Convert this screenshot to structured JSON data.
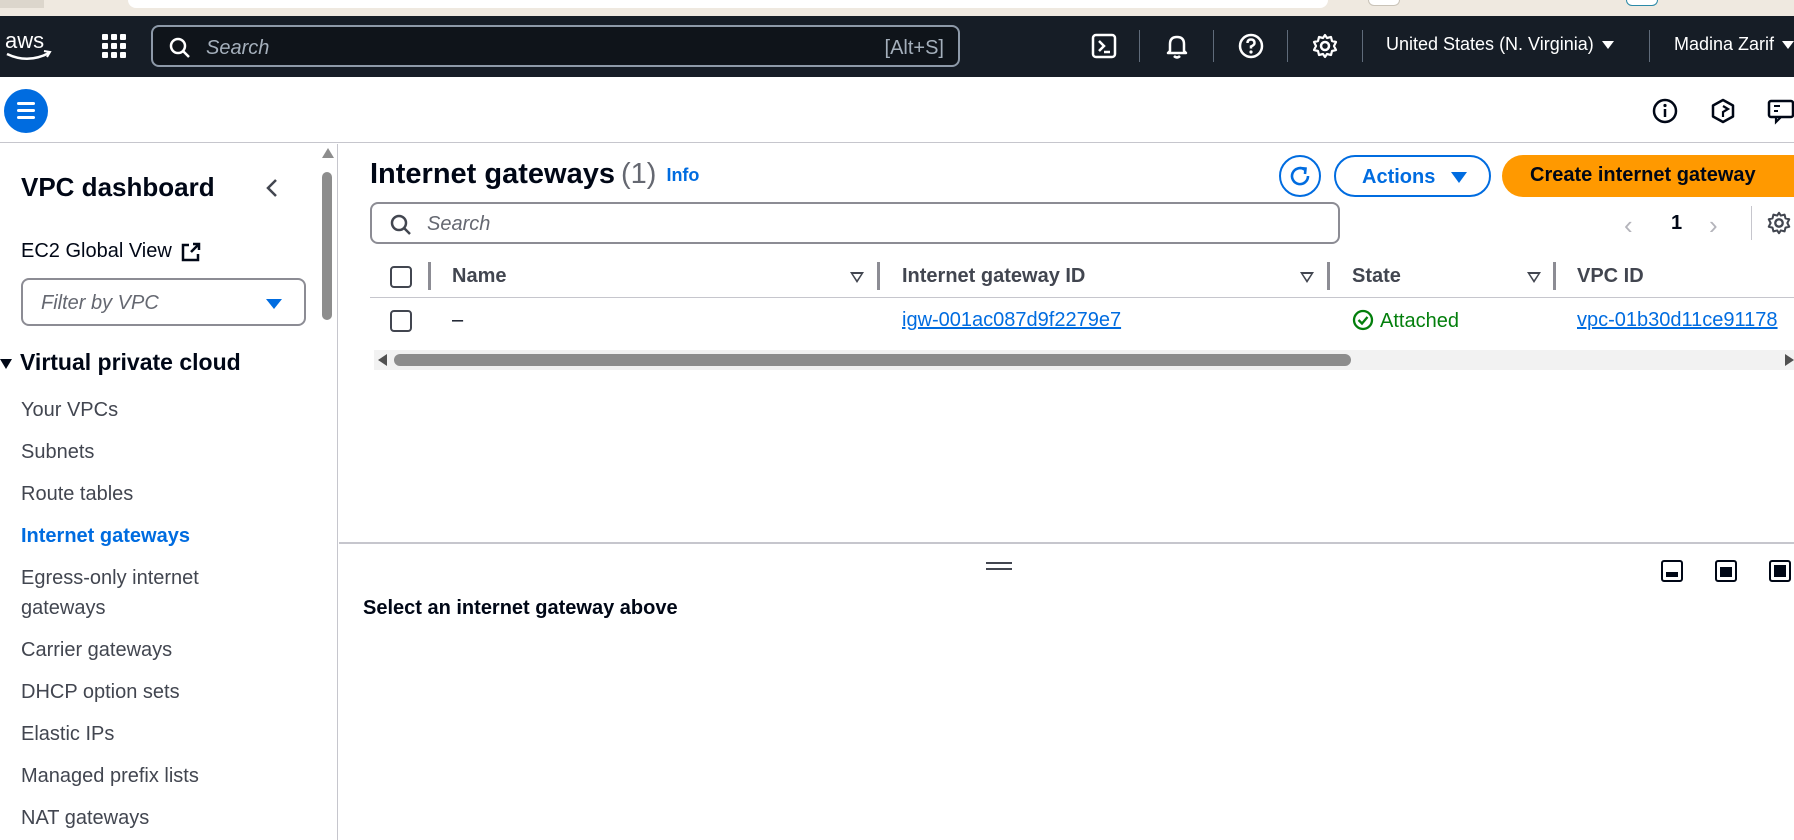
{
  "topnav": {
    "logo_text": "aws",
    "search_placeholder": "Search",
    "search_shortcut": "[Alt+S]",
    "region": "United States (N. Virginia)",
    "user": "Madina Zarif",
    "icons": [
      "cloudshell-icon",
      "bell-icon",
      "help-icon",
      "settings-icon"
    ]
  },
  "subheader": {
    "icons": [
      "info-icon",
      "hexagon-icon",
      "feedback-icon"
    ]
  },
  "sidebar": {
    "title": "VPC dashboard",
    "ec2_global_view": "EC2 Global View",
    "filter_placeholder": "Filter by VPC",
    "section": "Virtual private cloud",
    "items": [
      {
        "label": "Your VPCs"
      },
      {
        "label": "Subnets"
      },
      {
        "label": "Route tables"
      },
      {
        "label": "Internet gateways",
        "active": true
      },
      {
        "label": "Egress-only internet"
      },
      {
        "label": "gateways"
      },
      {
        "label": "Carrier gateways"
      },
      {
        "label": "DHCP option sets"
      },
      {
        "label": "Elastic IPs"
      },
      {
        "label": "Managed prefix lists"
      },
      {
        "label": "NAT gateways"
      }
    ]
  },
  "main": {
    "title": "Internet gateways",
    "count": "(1)",
    "info": "Info",
    "actions_label": "Actions",
    "create_label": "Create internet gateway",
    "search_placeholder": "Search",
    "page": "1",
    "columns": [
      "Name",
      "Internet gateway ID",
      "State",
      "VPC ID"
    ],
    "rows": [
      {
        "name": "–",
        "id": "igw-001ac087d9f2279e7",
        "state": "Attached",
        "vpc_id": "vpc-01b30d11ce91178"
      }
    ]
  },
  "split_panel": {
    "message": "Select an internet gateway above"
  },
  "colors": {
    "nav_bg": "#161d26",
    "accent": "#006ce0",
    "primary_button": "#ff9900",
    "success": "#037f0c"
  }
}
